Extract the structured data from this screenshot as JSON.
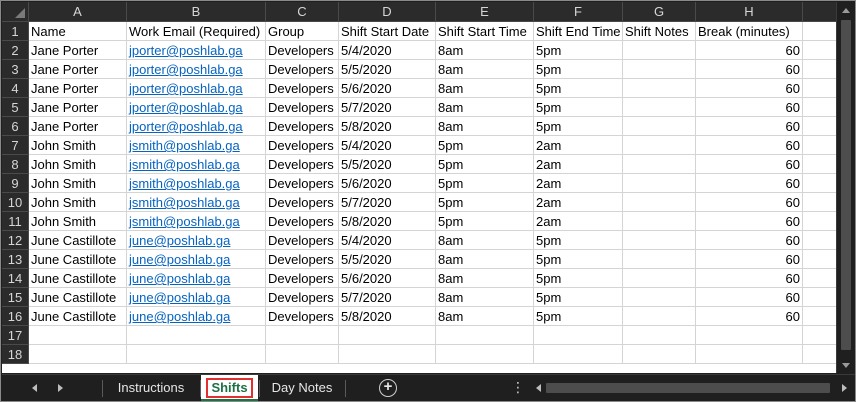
{
  "columns": [
    "A",
    "B",
    "C",
    "D",
    "E",
    "F",
    "G",
    "H"
  ],
  "rows": [
    {
      "n": "1",
      "cells": [
        "Name",
        "Work Email (Required)",
        "Group",
        "Shift Start Date",
        "Shift Start Time",
        "Shift End Time",
        "Shift Notes",
        "Break (minutes)"
      ]
    },
    {
      "n": "2",
      "cells": [
        "Jane Porter",
        "jporter@poshlab.ga",
        "Developers",
        "5/4/2020",
        "8am",
        "5pm",
        "",
        "60"
      ]
    },
    {
      "n": "3",
      "cells": [
        "Jane Porter",
        "jporter@poshlab.ga",
        "Developers",
        "5/5/2020",
        "8am",
        "5pm",
        "",
        "60"
      ]
    },
    {
      "n": "4",
      "cells": [
        "Jane Porter",
        "jporter@poshlab.ga",
        "Developers",
        "5/6/2020",
        "8am",
        "5pm",
        "",
        "60"
      ]
    },
    {
      "n": "5",
      "cells": [
        "Jane Porter",
        "jporter@poshlab.ga",
        "Developers",
        "5/7/2020",
        "8am",
        "5pm",
        "",
        "60"
      ]
    },
    {
      "n": "6",
      "cells": [
        "Jane Porter",
        "jporter@poshlab.ga",
        "Developers",
        "5/8/2020",
        "8am",
        "5pm",
        "",
        "60"
      ]
    },
    {
      "n": "7",
      "cells": [
        "John Smith",
        "jsmith@poshlab.ga",
        "Developers",
        "5/4/2020",
        "5pm",
        "2am",
        "",
        "60"
      ]
    },
    {
      "n": "8",
      "cells": [
        "John Smith",
        "jsmith@poshlab.ga",
        "Developers",
        "5/5/2020",
        "5pm",
        "2am",
        "",
        "60"
      ]
    },
    {
      "n": "9",
      "cells": [
        "John Smith",
        "jsmith@poshlab.ga",
        "Developers",
        "5/6/2020",
        "5pm",
        "2am",
        "",
        "60"
      ]
    },
    {
      "n": "10",
      "cells": [
        "John Smith",
        "jsmith@poshlab.ga",
        "Developers",
        "5/7/2020",
        "5pm",
        "2am",
        "",
        "60"
      ]
    },
    {
      "n": "11",
      "cells": [
        "John Smith",
        "jsmith@poshlab.ga",
        "Developers",
        "5/8/2020",
        "5pm",
        "2am",
        "",
        "60"
      ]
    },
    {
      "n": "12",
      "cells": [
        "June Castillote",
        "june@poshlab.ga",
        "Developers",
        "5/4/2020",
        "8am",
        "5pm",
        "",
        "60"
      ]
    },
    {
      "n": "13",
      "cells": [
        "June Castillote",
        "june@poshlab.ga",
        "Developers",
        "5/5/2020",
        "8am",
        "5pm",
        "",
        "60"
      ]
    },
    {
      "n": "14",
      "cells": [
        "June Castillote",
        "june@poshlab.ga",
        "Developers",
        "5/6/2020",
        "8am",
        "5pm",
        "",
        "60"
      ]
    },
    {
      "n": "15",
      "cells": [
        "June Castillote",
        "june@poshlab.ga",
        "Developers",
        "5/7/2020",
        "8am",
        "5pm",
        "",
        "60"
      ]
    },
    {
      "n": "16",
      "cells": [
        "June Castillote",
        "june@poshlab.ga",
        "Developers",
        "5/8/2020",
        "8am",
        "5pm",
        "",
        "60"
      ]
    },
    {
      "n": "17",
      "cells": [
        "",
        "",
        "",
        "",
        "",
        "",
        "",
        ""
      ]
    },
    {
      "n": "18",
      "cells": [
        "",
        "",
        "",
        "",
        "",
        "",
        "",
        ""
      ]
    }
  ],
  "tabs": {
    "instructions": "Instructions",
    "shifts": "Shifts",
    "day_notes": "Day Notes",
    "add_symbol": "+",
    "more_symbol": "⋮"
  },
  "colors": {
    "link": "#0563c1",
    "active_tab_text": "#1e7145",
    "highlight_border": "#e03030",
    "chrome_bg": "#1f1f1f"
  },
  "icons": [
    "scroll-left-icon",
    "scroll-right-icon",
    "add-sheet-icon",
    "more-options-icon",
    "scroll-up-icon",
    "scroll-down-icon"
  ]
}
